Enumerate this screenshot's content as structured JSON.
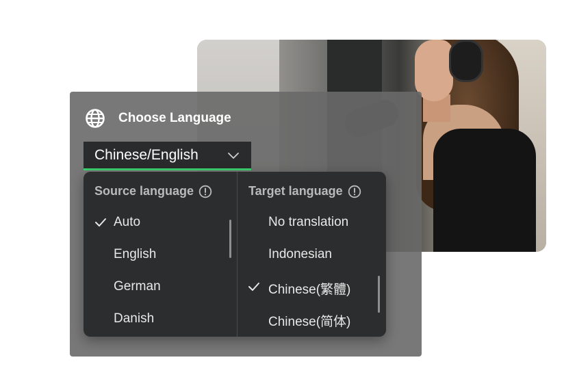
{
  "panel": {
    "title": "Choose Language",
    "selected_pair": "Chinese/English"
  },
  "source": {
    "heading": "Source language",
    "options": [
      {
        "label": "Auto",
        "selected": true
      },
      {
        "label": "English",
        "selected": false
      },
      {
        "label": "German",
        "selected": false
      },
      {
        "label": "Danish",
        "selected": false
      }
    ]
  },
  "target": {
    "heading": "Target language",
    "options": [
      {
        "label": "No translation",
        "selected": false
      },
      {
        "label": "Indonesian",
        "selected": false
      },
      {
        "label": "Chinese(繁體)",
        "selected": true
      },
      {
        "label": "Chinese(简体)",
        "selected": false
      }
    ]
  },
  "colors": {
    "accent": "#3bd16f",
    "dropdown_bg": "#2c2d2e",
    "panel_bg": "#696969"
  },
  "icons": [
    "globe-icon",
    "chevron-down-icon",
    "info-icon",
    "checkmark-icon"
  ]
}
